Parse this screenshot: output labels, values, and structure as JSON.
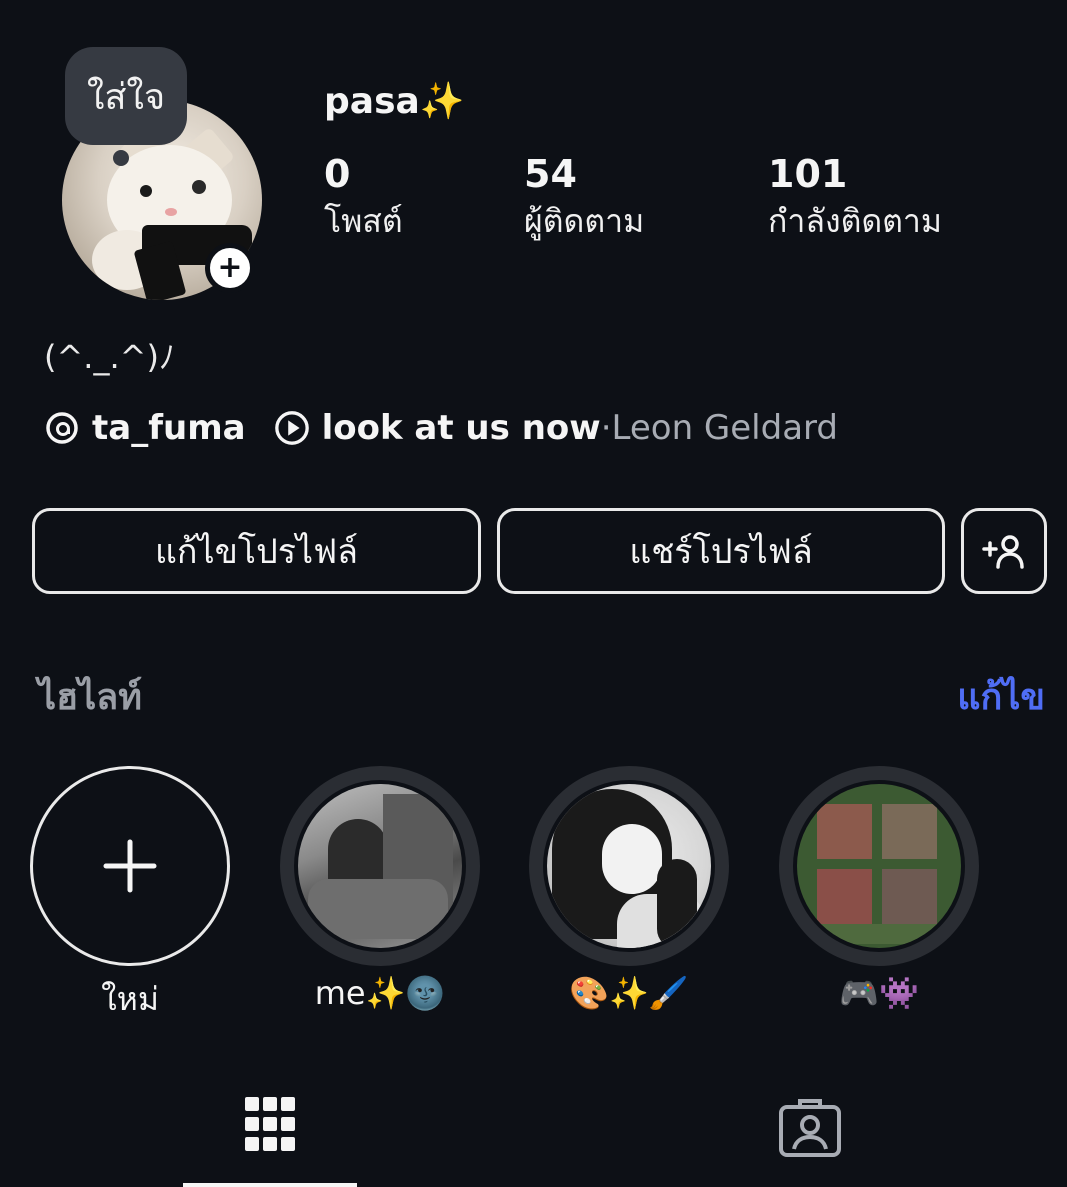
{
  "profile": {
    "bubble_text": "ใส่ใจ",
    "username": "pasa✨",
    "add_badge": "+",
    "stats": [
      {
        "value": "0",
        "label": "โพสต์"
      },
      {
        "value": "54",
        "label": "ผู้ติดตาม"
      },
      {
        "value": "101",
        "label": "กำลังติดตาม"
      }
    ],
    "bio": "(^._.^)ﾉ",
    "threads_handle": "ta_fuma",
    "music_title": "look at us now",
    "music_separator": " · ",
    "music_artist": "Leon Geldard"
  },
  "actions": {
    "edit_profile": "แก้ไขโปรไฟล์",
    "share_profile": "แชร์โปรไฟล์"
  },
  "highlights": {
    "title": "ไฮไลท์",
    "edit": "แก้ไข",
    "new_label": "ใหม่",
    "items": [
      {
        "label": "me✨🌚"
      },
      {
        "label": "🎨✨🖌️"
      },
      {
        "label": "🎮👾"
      }
    ]
  },
  "colors": {
    "background": "#0d1016",
    "accent": "#4f6df5"
  },
  "tabs": {
    "grid": "grid-icon",
    "tagged": "tagged-icon"
  }
}
